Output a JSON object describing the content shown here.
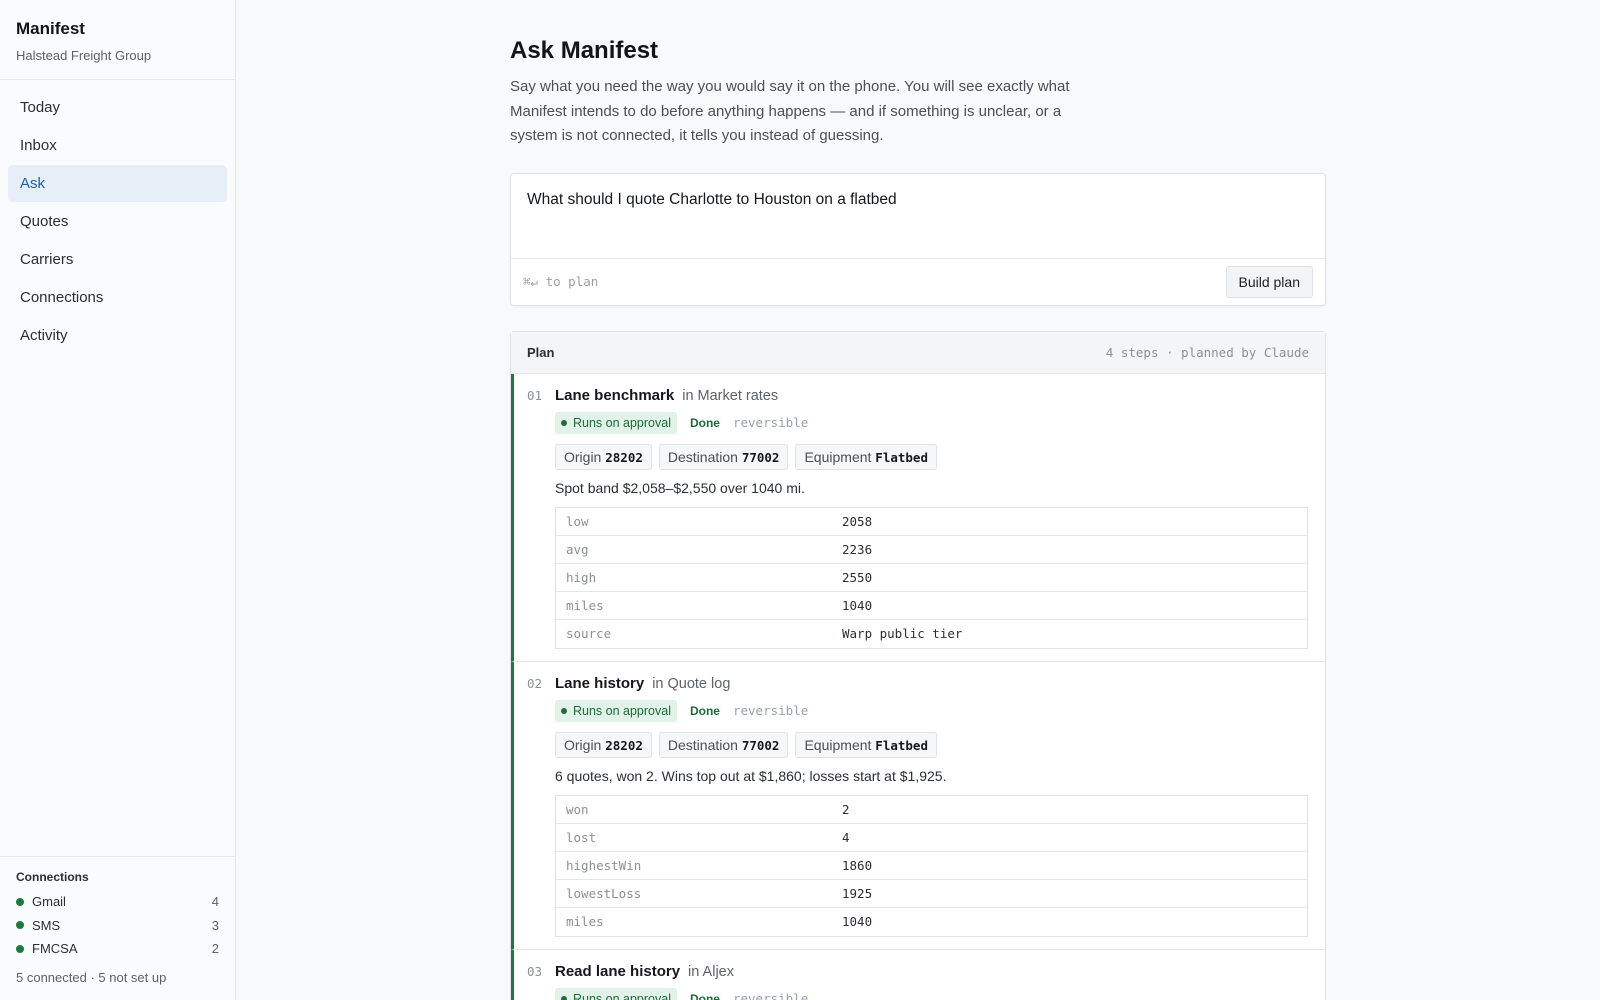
{
  "app": {
    "name": "Manifest",
    "org": "Halstead Freight Group"
  },
  "nav": [
    {
      "label": "Today",
      "active": false
    },
    {
      "label": "Inbox",
      "active": false
    },
    {
      "label": "Ask",
      "active": true
    },
    {
      "label": "Quotes",
      "active": false
    },
    {
      "label": "Carriers",
      "active": false
    },
    {
      "label": "Connections",
      "active": false
    },
    {
      "label": "Activity",
      "active": false
    }
  ],
  "sidebar_footer": {
    "title": "Connections",
    "items": [
      {
        "name": "Gmail",
        "count": "4",
        "status_color": "#1c7a3f"
      },
      {
        "name": "SMS",
        "count": "3",
        "status_color": "#1c7a3f"
      },
      {
        "name": "FMCSA",
        "count": "2",
        "status_color": "#1c7a3f"
      }
    ],
    "summary": "5 connected · 5 not set up"
  },
  "page": {
    "title": "Ask Manifest",
    "intro": "Say what you need the way you would say it on the phone. You will see exactly what Manifest intends to do before anything happens — and if something is unclear, or a system is not connected, it tells you instead of guessing."
  },
  "ask": {
    "query": "What should I quote Charlotte to Houston on a flatbed",
    "hint": "⌘↵ to plan",
    "button": "Build plan"
  },
  "plan": {
    "title": "Plan",
    "meta": "4 steps · planned by Claude",
    "steps": [
      {
        "num": "01",
        "title": "Lane benchmark",
        "system": "in Market rates",
        "approval": "Runs on approval",
        "status": "Done",
        "reversible": "reversible",
        "chips": [
          {
            "label": "Origin",
            "value": "28202"
          },
          {
            "label": "Destination",
            "value": "77002"
          },
          {
            "label": "Equipment",
            "value": "Flatbed"
          }
        ],
        "summary": "Spot band $2,058–$2,550 over 1040 mi.",
        "rows": [
          {
            "key": "low",
            "value": "2058"
          },
          {
            "key": "avg",
            "value": "2236"
          },
          {
            "key": "high",
            "value": "2550"
          },
          {
            "key": "miles",
            "value": "1040"
          },
          {
            "key": "source",
            "value": "Warp public tier"
          }
        ]
      },
      {
        "num": "02",
        "title": "Lane history",
        "system": "in Quote log",
        "approval": "Runs on approval",
        "status": "Done",
        "reversible": "reversible",
        "chips": [
          {
            "label": "Origin",
            "value": "28202"
          },
          {
            "label": "Destination",
            "value": "77002"
          },
          {
            "label": "Equipment",
            "value": "Flatbed"
          }
        ],
        "summary": "6 quotes, won 2. Wins top out at $1,860; losses start at $1,925.",
        "rows": [
          {
            "key": "won",
            "value": "2"
          },
          {
            "key": "lost",
            "value": "4"
          },
          {
            "key": "highestWin",
            "value": "1860"
          },
          {
            "key": "lowestLoss",
            "value": "1925"
          },
          {
            "key": "miles",
            "value": "1040"
          }
        ]
      },
      {
        "num": "03",
        "title": "Read lane history",
        "system": "in Aljex",
        "approval": "Runs on approval",
        "status": "Done",
        "reversible": "reversible"
      }
    ]
  }
}
